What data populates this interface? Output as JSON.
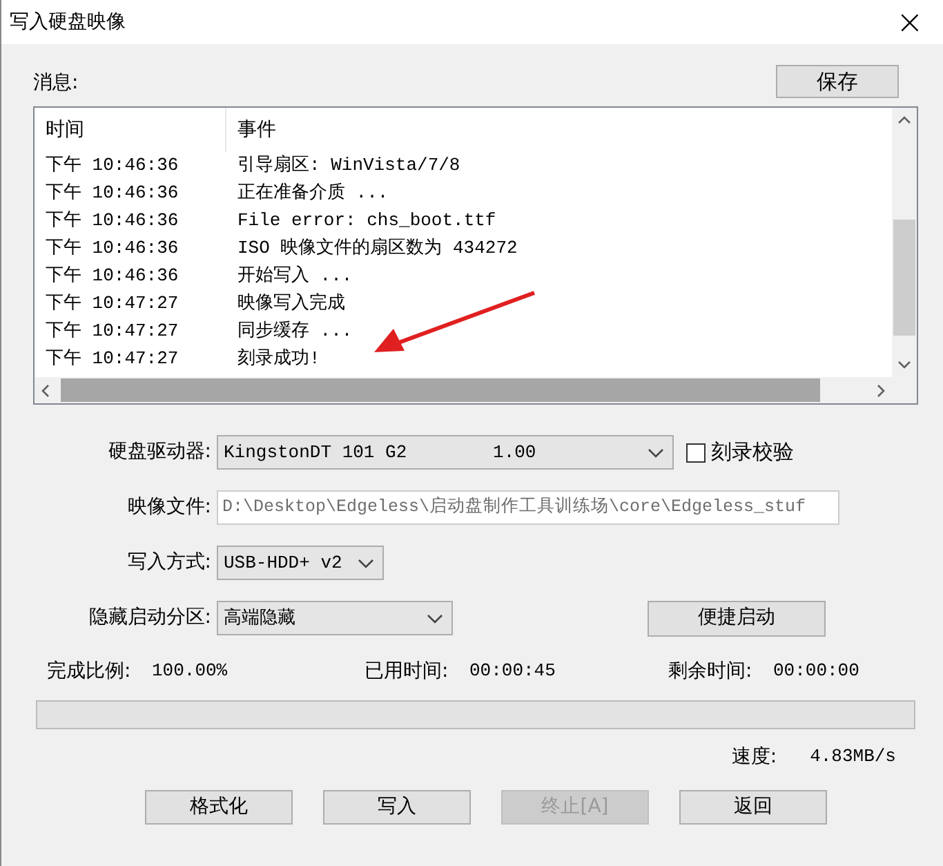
{
  "window": {
    "title": "写入硬盘映像",
    "close": "×"
  },
  "messages": {
    "label": "消息:",
    "save_button": "保存",
    "columns": [
      "时间",
      "事件"
    ],
    "rows": [
      {
        "time": "下午 10:46:36",
        "event": "引导扇区: WinVista/7/8"
      },
      {
        "time": "下午 10:46:36",
        "event": "正在准备介质 ..."
      },
      {
        "time": "下午 10:46:36",
        "event": "File error: chs_boot.ttf"
      },
      {
        "time": "下午 10:46:36",
        "event": "ISO 映像文件的扇区数为 434272"
      },
      {
        "time": "下午 10:46:36",
        "event": "开始写入 ..."
      },
      {
        "time": "下午 10:47:27",
        "event": "映像写入完成"
      },
      {
        "time": "下午 10:47:27",
        "event": "同步缓存 ..."
      },
      {
        "time": "下午 10:47:27",
        "event": "刻录成功!"
      }
    ]
  },
  "form": {
    "drive": {
      "label": "硬盘驱动器:",
      "value": "KingstonDT 101 G2        1.00"
    },
    "verify": {
      "label": "刻录校验",
      "checked": false
    },
    "image_file": {
      "label": "映像文件:",
      "value": "D:\\Desktop\\Edgeless\\启动盘制作工具训练场\\core\\Edgeless_stuf"
    },
    "write_mode": {
      "label": "写入方式:",
      "value": "USB-HDD+ v2"
    },
    "hide_partition": {
      "label": "隐藏启动分区:",
      "value": "高端隐藏"
    },
    "quick_boot_button": "便捷启动"
  },
  "progress": {
    "stats": [
      {
        "label": "完成比例:",
        "value": "100.00%"
      },
      {
        "label": "已用时间:",
        "value": "00:00:45"
      },
      {
        "label": "剩余时间:",
        "value": "00:00:00"
      }
    ],
    "level": 1,
    "speed_label": "速度:",
    "speed": "4.83MB/s"
  },
  "buttons": [
    {
      "label": "格式化",
      "disabled": false
    },
    {
      "label": "写入",
      "disabled": false
    },
    {
      "label": "终止[A]",
      "disabled": true
    },
    {
      "label": "返回",
      "disabled": false
    }
  ]
}
